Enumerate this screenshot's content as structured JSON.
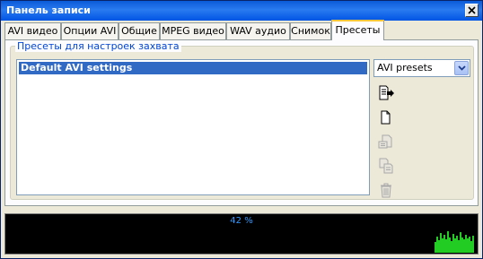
{
  "window": {
    "title": "Панель записи"
  },
  "tabs": [
    {
      "label": "AVI видео"
    },
    {
      "label": "Опции AVI"
    },
    {
      "label": "Общие"
    },
    {
      "label": "MPEG видео"
    },
    {
      "label": "WAV аудио"
    },
    {
      "label": "Снимок"
    },
    {
      "label": "Пресеты",
      "active": true
    }
  ],
  "presets": {
    "group_title": "Пресеты для настроек захвата",
    "items": [
      {
        "label": "Default AVI settings",
        "selected": true
      }
    ],
    "dropdown_value": "AVI presets"
  },
  "buttons": [
    {
      "icon": "apply-preset-icon",
      "enabled": true
    },
    {
      "icon": "new-document-icon",
      "enabled": true
    },
    {
      "icon": "edit-preset-icon",
      "enabled": false
    },
    {
      "icon": "copy-preset-icon",
      "enabled": false
    },
    {
      "icon": "trash-icon",
      "enabled": false
    }
  ],
  "status": {
    "progress_text": "42 %",
    "progress": 0.42
  },
  "colors": {
    "selection": "#316ac5",
    "group_title": "#0046d5",
    "meter_text": "#3399ff",
    "meter_bars": "#22cc22"
  }
}
